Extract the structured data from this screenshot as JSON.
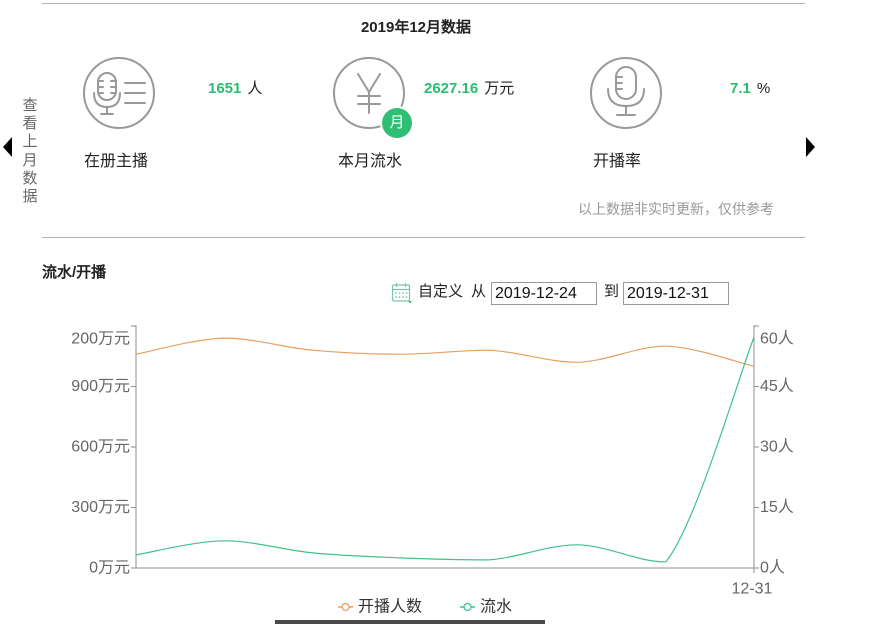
{
  "header": {
    "title": "2019年12月数据"
  },
  "nav": {
    "prev_label": "查看上月数据"
  },
  "stats": [
    {
      "icon": "podcast-host-icon",
      "label": "在册主播",
      "value": "1651",
      "unit": "人"
    },
    {
      "icon": "yen-icon",
      "badge": "月",
      "label": "本月流水",
      "value": "2627.16",
      "unit": "万元"
    },
    {
      "icon": "microphone-icon",
      "label": "开播率",
      "value": "7.1",
      "unit": "%"
    }
  ],
  "note": "以上数据非实时更新，仅供参考",
  "filter": {
    "range_label": "自定义",
    "from_label": "从",
    "from_value": "2019-12-24",
    "to_label": "到",
    "to_value": "2019-12-31"
  },
  "colors": {
    "accent": "#28bd6c",
    "badge": "#2fbf74",
    "icon_stroke": "#999999",
    "divider": "#b3b3b3"
  },
  "chart_data": {
    "type": "line",
    "title": "流水/开播",
    "smooth": true,
    "grid": false,
    "legend_position": "bottom-center",
    "categories": [
      "",
      "",
      "",
      "",
      "",
      "",
      "",
      "12-31"
    ],
    "y_left": {
      "range": [
        0,
        1200
      ],
      "ticks": [
        {
          "value": 0,
          "label": "0万元"
        },
        {
          "value": 300,
          "label": "300万元"
        },
        {
          "value": 600,
          "label": "600万元"
        },
        {
          "value": 900,
          "label": "900万元"
        },
        {
          "value": 1200,
          "label": "200万元"
        }
      ]
    },
    "y_right": {
      "range": [
        0,
        60
      ],
      "ticks": [
        {
          "value": 0,
          "label": "0人"
        },
        {
          "value": 15,
          "label": "15人"
        },
        {
          "value": 30,
          "label": "30人"
        },
        {
          "value": 45,
          "label": "45人"
        },
        {
          "value": 60,
          "label": "60人"
        }
      ]
    },
    "series": [
      {
        "name": "开播人数",
        "axis": "right",
        "color": "#e8a062",
        "values": [
          53,
          57,
          54,
          53,
          54,
          51,
          55,
          50
        ]
      },
      {
        "name": "流水",
        "axis": "left",
        "color": "#3ec28a",
        "values": [
          65,
          135,
          75,
          50,
          40,
          115,
          30,
          1145
        ]
      }
    ]
  }
}
